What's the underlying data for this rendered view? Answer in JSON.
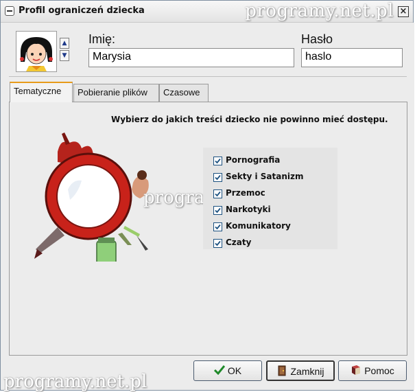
{
  "window": {
    "title": "Profil ograniczeń dziecka",
    "watermark": "programy.net.pl"
  },
  "profile": {
    "name_label": "Imię:",
    "name_value": "Marysia",
    "password_label": "Hasło",
    "password_value": "haslo"
  },
  "tabs": [
    {
      "label": "Tematyczne",
      "active": true
    },
    {
      "label": "Pobieranie plików",
      "active": false
    },
    {
      "label": "Czasowe",
      "active": false
    }
  ],
  "panel": {
    "instruction": "Wybierz do jakich treści dziecko nie powinno mieć dostępu.",
    "categories": [
      {
        "label": "Pornografia",
        "checked": true
      },
      {
        "label": "Sekty i Satanizm",
        "checked": true
      },
      {
        "label": "Przemoc",
        "checked": true
      },
      {
        "label": "Narkotyki",
        "checked": true
      },
      {
        "label": "Komunikatory",
        "checked": true
      },
      {
        "label": "Czaty",
        "checked": true
      }
    ]
  },
  "buttons": {
    "ok": "OK",
    "close": "Zamknij",
    "help": "Pomoc"
  },
  "icons": {
    "ok": "check-icon",
    "close": "door-exit-icon",
    "help": "book-icon"
  }
}
